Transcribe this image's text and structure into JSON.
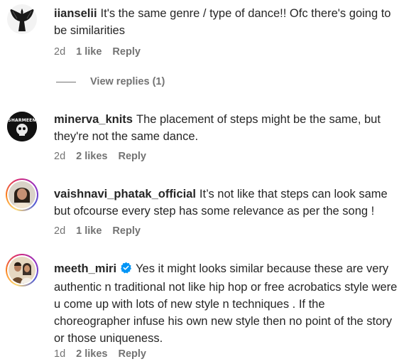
{
  "comments": [
    {
      "username": "iianselii",
      "text": "It's the same genre / type of dance!! Ofc there's going to be similarities",
      "time": "2d",
      "likes": "1 like",
      "reply": "Reply",
      "view_replies": "View replies (1)"
    },
    {
      "username": "minerva_knits",
      "text": "The placement of steps might be the same, but they're not the same dance.",
      "time": "2d",
      "likes": "2 likes",
      "reply": "Reply",
      "avatar_text": "SHARMEEN"
    },
    {
      "username": "vaishnavi_phatak_official",
      "text": "It’s not like that steps can look same but ofcourse every step has some relevance as per the song !",
      "time": "2d",
      "likes": "1 like",
      "reply": "Reply"
    },
    {
      "username": "meeth_miri",
      "verified": true,
      "text": "Yes it might looks similar because these are very authentic n traditional not like hip hop or free acrobatics style were u come up with lots of new style n techniques . If the choreographer infuse his own new style then no point of the story or those uniqueness.",
      "time": "1d",
      "likes": "2 likes",
      "reply": "Reply"
    }
  ],
  "colors": {
    "text": "#262626",
    "secondary": "#737373",
    "verified": "#0095f6"
  }
}
